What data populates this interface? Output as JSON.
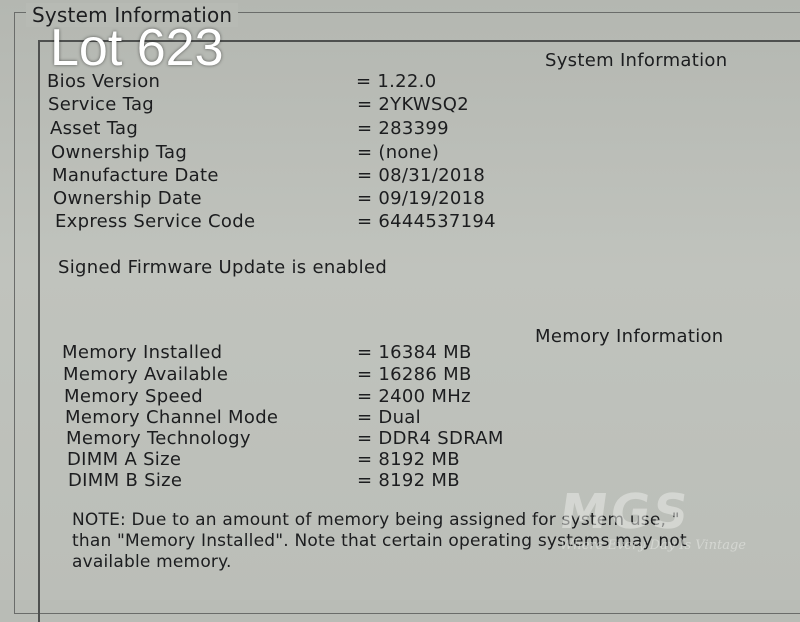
{
  "outer_title": "System Information",
  "overlay_label": "Lot 623",
  "system": {
    "heading": "System Information",
    "rows": [
      {
        "label": "Bios Version",
        "value": "= 1.22.0"
      },
      {
        "label": "Service Tag",
        "value": "= 2YKWSQ2"
      },
      {
        "label": "Asset Tag",
        "value": "= 283399"
      },
      {
        "label": "Ownership Tag",
        "value": "= (none)"
      },
      {
        "label": "Manufacture Date",
        "value": "= 08/31/2018"
      },
      {
        "label": "Ownership Date",
        "value": "= 09/19/2018"
      },
      {
        "label": "Express Service Code",
        "value": "= 6444537194"
      }
    ],
    "firmware_status": "Signed Firmware Update is enabled"
  },
  "memory": {
    "heading": "Memory Information",
    "rows": [
      {
        "label": "Memory Installed",
        "value": "= 16384 MB"
      },
      {
        "label": "Memory Available",
        "value": "= 16286 MB"
      },
      {
        "label": "Memory Speed",
        "value": "= 2400 MHz"
      },
      {
        "label": "Memory Channel Mode",
        "value": "= Dual"
      },
      {
        "label": "Memory Technology",
        "value": "= DDR4 SDRAM"
      },
      {
        "label": "DIMM A Size",
        "value": "= 8192 MB"
      },
      {
        "label": "DIMM B Size",
        "value": "= 8192 MB"
      }
    ],
    "note_lines": [
      "NOTE: Due to an amount of memory being assigned for system use, \"",
      "than \"Memory Installed\". Note that certain operating systems may not",
      "available memory."
    ]
  },
  "watermark": {
    "logo": "MGS",
    "tagline": "Where Every Day Is Vintage"
  }
}
